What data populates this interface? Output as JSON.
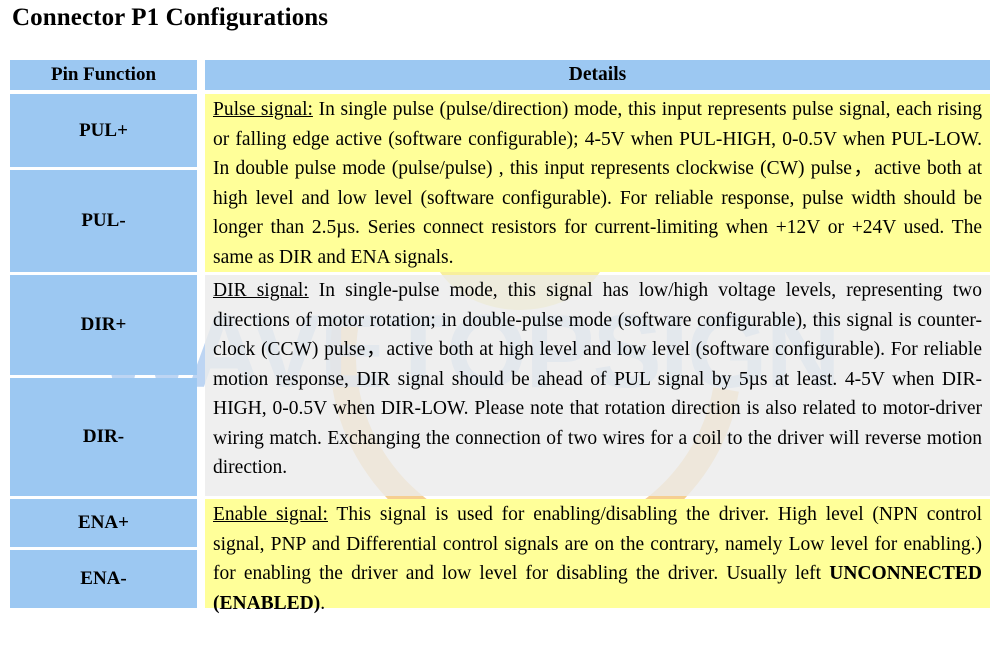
{
  "document": {
    "title": "Connector P1 Configurations",
    "watermark": "WAVETOPSIGN"
  },
  "table": {
    "headers": {
      "pin_function": "Pin Function",
      "details": "Details"
    },
    "pins": [
      {
        "label": "PUL+"
      },
      {
        "label": "PUL-"
      },
      {
        "label": "DIR+"
      },
      {
        "label": "DIR-"
      },
      {
        "label": "ENA+"
      },
      {
        "label": "ENA-"
      }
    ],
    "details": [
      {
        "group": "pulse",
        "lead": "Pulse signal:",
        "body": " In single pulse (pulse/direction) mode, this input represents pulse signal, each rising or falling edge active (software configurable); 4-5V when PUL-HIGH, 0-0.5V when PUL-LOW. In double pulse mode (pulse/pulse) , this input represents clockwise (CW) pulse，active both at high level and low level (software configurable). For reliable response, pulse width should be longer than 2.5µs. Series connect resistors for current-limiting when +12V or +24V used. The same as DIR and ENA signals.",
        "background": "#ffff99"
      },
      {
        "group": "dir",
        "lead": "DIR signal:",
        "body": " In single-pulse mode, this signal has low/high voltage levels, representing two directions of motor rotation; in double-pulse mode (software configurable), this signal is counter-clock (CCW) pulse，active both at high level and low level (software configurable). For reliable motion response, DIR signal should be ahead of PUL signal by 5µs at least. 4-5V when DIR-HIGH, 0-0.5V when DIR-LOW. Please note that rotation direction is also related to motor-driver wiring match. Exchanging the connection of two wires for a coil to the driver will reverse motion direction.",
        "background": "#ececec"
      },
      {
        "group": "ena",
        "lead": "Enable signal:",
        "body": " This signal is used for enabling/disabling the driver. High level (NPN control signal, PNP and Differential control signals are on the contrary, namely Low level for enabling.) for enabling the driver and low level for disabling the driver. Usually left ",
        "emphasis": "UNCONNECTED (ENABLED)",
        "body_tail": ".",
        "background": "#ffff99"
      }
    ],
    "colors": {
      "pin_cell": "#9cc8f2",
      "header": "#9cc8f2",
      "highlight": "#ffff99",
      "plain": "#ececec",
      "text": "#000000"
    }
  }
}
